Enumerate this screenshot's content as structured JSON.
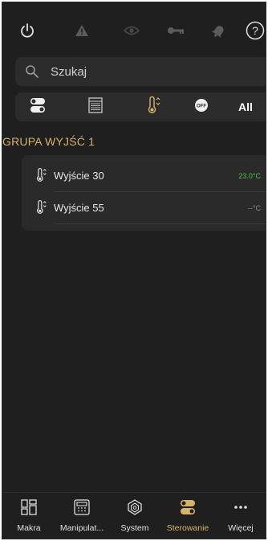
{
  "topbar": {
    "icons": [
      "power-icon",
      "warning-icon",
      "eye-icon",
      "key-icon",
      "bell-icon",
      "help-icon"
    ]
  },
  "search": {
    "placeholder": "Szukaj"
  },
  "filters": {
    "items": [
      "toggle-icon",
      "window-blind-icon",
      "thermometer-icon",
      "off-icon"
    ],
    "all_label": "All"
  },
  "group": {
    "title": "GRUPA WYJŚĆ 1",
    "rows": [
      {
        "name": "Wyjście 30",
        "value": "23.0°C",
        "value_color": "#4cc24c"
      },
      {
        "name": "Wyjście 55",
        "value": "--°C",
        "value_color": "#8a8a8a"
      }
    ]
  },
  "bottomnav": {
    "items": [
      {
        "label": "Makra",
        "icon": "macros-icon"
      },
      {
        "label": "Manipulat...",
        "icon": "keypad-icon"
      },
      {
        "label": "System",
        "icon": "system-icon"
      },
      {
        "label": "Sterowanie",
        "icon": "toggle-icon",
        "active": true
      },
      {
        "label": "Więcej",
        "icon": "more-icon"
      }
    ]
  },
  "colors": {
    "accent": "#d6b36b",
    "background": "#1f1f1f",
    "card": "#2c2c2c",
    "ok": "#4cc24c"
  }
}
